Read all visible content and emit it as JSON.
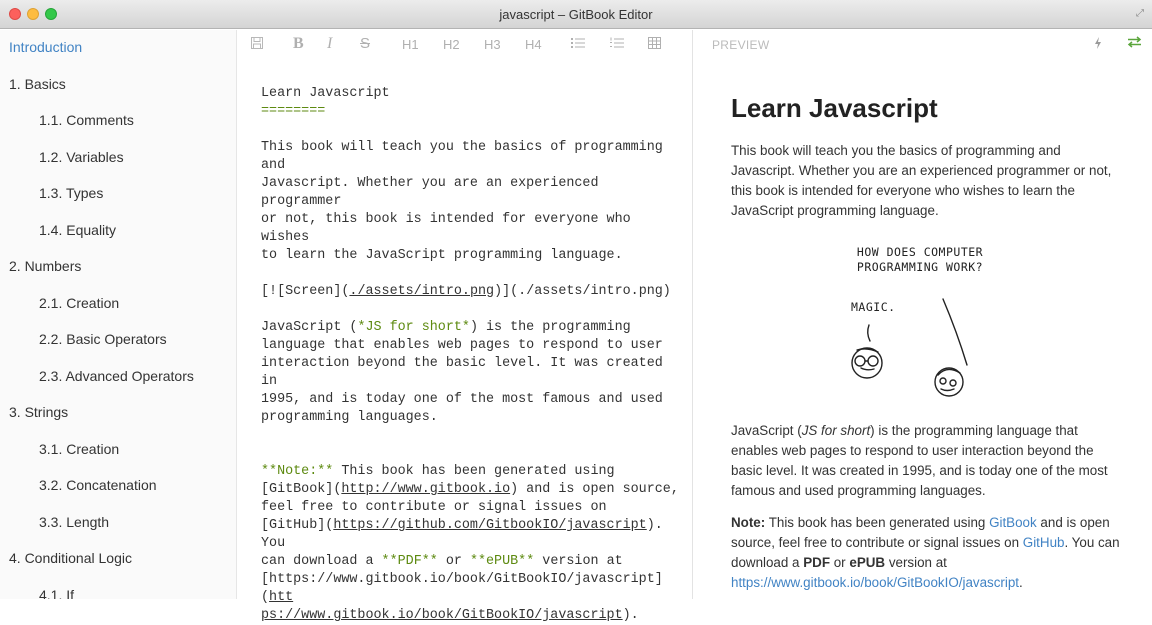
{
  "window": {
    "title": "javascript – GitBook Editor"
  },
  "sidebar": {
    "items": [
      {
        "label": "Introduction",
        "level": 1,
        "active": true
      },
      {
        "label": "1. Basics",
        "level": 1
      },
      {
        "label": "1.1. Comments",
        "level": 2
      },
      {
        "label": "1.2. Variables",
        "level": 2
      },
      {
        "label": "1.3. Types",
        "level": 2
      },
      {
        "label": "1.4. Equality",
        "level": 2
      },
      {
        "label": "2. Numbers",
        "level": 1
      },
      {
        "label": "2.1. Creation",
        "level": 2
      },
      {
        "label": "2.2. Basic Operators",
        "level": 2
      },
      {
        "label": "2.3. Advanced Operators",
        "level": 2
      },
      {
        "label": "3. Strings",
        "level": 1
      },
      {
        "label": "3.1. Creation",
        "level": 2
      },
      {
        "label": "3.2. Concatenation",
        "level": 2
      },
      {
        "label": "3.3. Length",
        "level": 2
      },
      {
        "label": "4. Conditional Logic",
        "level": 1
      },
      {
        "label": "4.1. If",
        "level": 2
      }
    ]
  },
  "toolbar": {
    "bold": "B",
    "italic": "I",
    "strike": "S",
    "h1": "H1",
    "h2": "H2",
    "h3": "H3",
    "h4": "H4"
  },
  "editor": {
    "title": "Learn Javascript",
    "title_underline": "========",
    "para1": [
      "This book will teach you the basics of programming and",
      "Javascript. Whether you are an experienced programmer",
      "or not, this book is intended for everyone who wishes",
      "to learn the JavaScript programming language."
    ],
    "image_line": {
      "a": "[![Screen](",
      "b": "./assets/intro.png",
      "c": ")](./assets/intro.png)"
    },
    "para2_first": {
      "a": "JavaScript (",
      "b": "*JS for short*",
      "c": ") is the programming"
    },
    "para2_rest": [
      "language that enables web pages to respond to user",
      "interaction beyond the basic level. It was created in",
      "1995, and is today one of the most famous and used",
      "programming languages."
    ],
    "note": {
      "l1a": "**Note:**",
      "l1b": " This book has been generated using",
      "l2a": "[GitBook](",
      "l2b": "http://www.gitbook.io",
      "l2c": ") and is open source,",
      "l3": "feel free to contribute or signal issues on",
      "l4a": "[GitHub](",
      "l4b": "https://github.com/GitbookIO/javascript",
      "l4c": "). You",
      "l5a": "can download a ",
      "l5b": "**PDF**",
      "l5c": " or ",
      "l5d": "**ePUB**",
      "l5e": " version at",
      "l6a": "[https://www.gitbook.io/book/GitBookIO/javascript](",
      "l6b": "htt",
      "l7a": "ps://www.gitbook.io/book/GitBookIO/javascript",
      "l7b": ")."
    }
  },
  "preview": {
    "label": "PREVIEW",
    "title": "Learn Javascript",
    "para1": "This book will teach you the basics of programming and Javascript. Whether you are an experienced programmer or not, this book is intended for everyone who wishes to learn the JavaScript programming language.",
    "comic_caption_1": "HOW DOES COMPUTER",
    "comic_caption_2": "PROGRAMMING WORK?",
    "comic_magic": "MAGIC.",
    "para2_a": "JavaScript (",
    "para2_em": "JS for short",
    "para2_b": ") is the programming language that enables web pages to respond to user interaction beyond the basic level. It was created in 1995, and is today one of the most famous and used programming languages.",
    "note_label": "Note:",
    "note_a": " This book has been generated using ",
    "note_link1": "GitBook",
    "note_b": " and is open source, feel free to contribute or signal issues on ",
    "note_link2": "GitHub",
    "note_c": ". You can download a ",
    "note_pdf": "PDF",
    "note_d": " or ",
    "note_epub": "ePUB",
    "note_e": " version at ",
    "note_link3": "https://www.gitbook.io/book/GitBookIO/javascript",
    "note_f": "."
  },
  "icons": {
    "save": "save-icon",
    "bolt": "lightning-icon",
    "sync": "sync-arrows-icon"
  },
  "colors": {
    "link": "#4183c4",
    "markdown_accent": "#5d8a10",
    "sync_green": "#5aa53b"
  }
}
